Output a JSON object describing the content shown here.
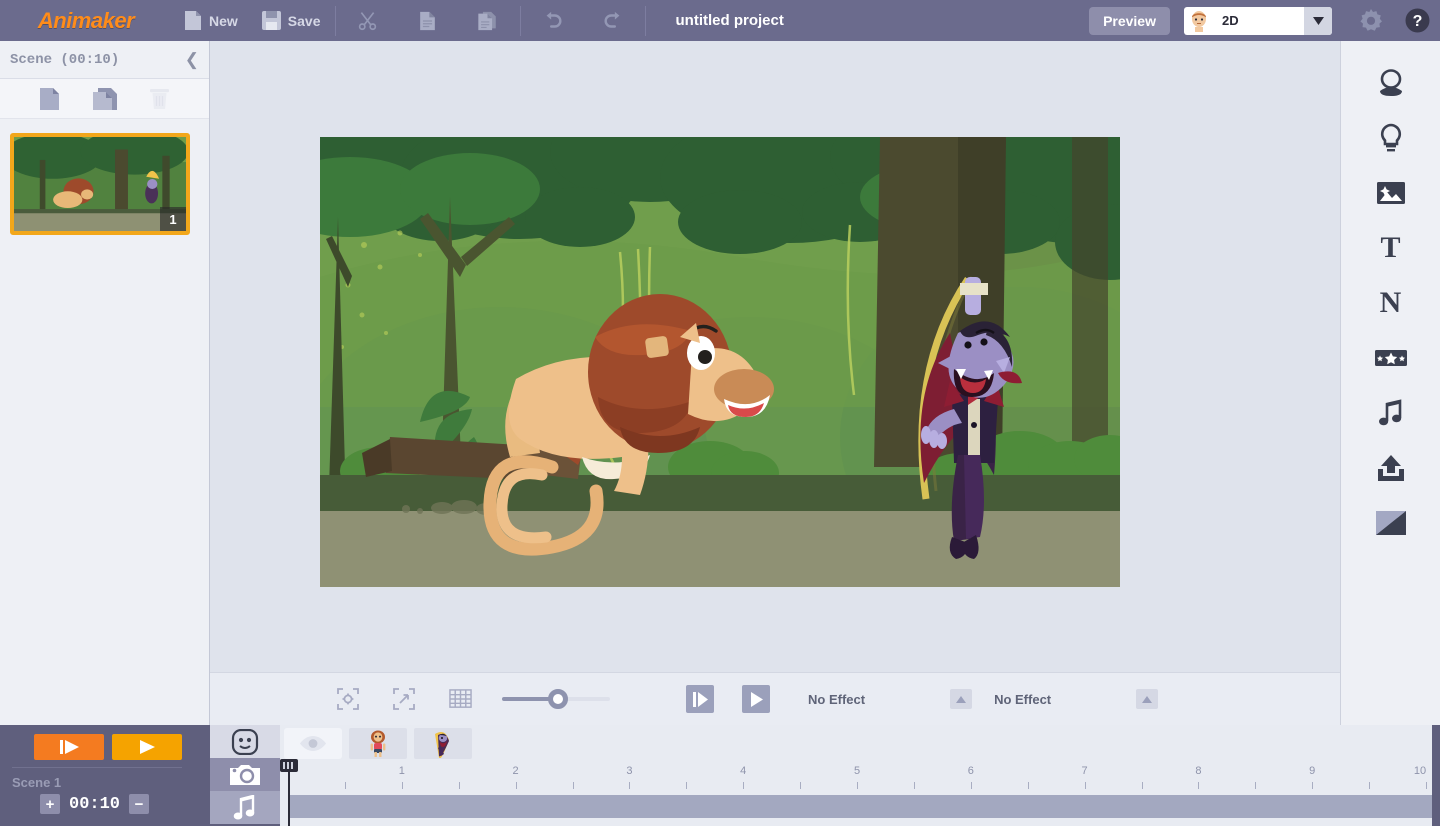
{
  "app": {
    "brand": "Animaker",
    "project_title": "untitled project"
  },
  "toolbar": {
    "new_label": "New",
    "save_label": "Save",
    "cut_icon": "scissors-icon",
    "copy_icon": "copy-icon",
    "paste_icon": "paste-icon",
    "undo_icon": "undo-icon",
    "redo_icon": "redo-icon",
    "preview_label": "Preview",
    "mode_value": "2D",
    "settings_icon": "gear-icon",
    "help_icon": "help-icon"
  },
  "scene_panel": {
    "title": "Scene  (00:10)",
    "collapse_icon": "chevron-left-icon",
    "new_scene_icon": "new-page-icon",
    "duplicate_scene_icon": "duplicate-page-icon",
    "delete_scene_icon": "trash-icon",
    "scenes": [
      {
        "number": "1",
        "selected": true
      }
    ]
  },
  "canvas_toolbar": {
    "center_icon": "center-target-icon",
    "fit_icon": "fit-expand-icon",
    "grid_icon": "grid-icon",
    "zoom_percent": 50,
    "enter_effect_icon": "enter-effect-icon",
    "exit_effect_icon": "exit-effect-icon",
    "enter_effect_label": "No Effect",
    "exit_effect_label": "No Effect",
    "caret_icon": "caret-up-icon"
  },
  "right_rail": {
    "items": [
      {
        "icon": "character-icon",
        "name": "characters"
      },
      {
        "icon": "bulb-icon",
        "name": "properties"
      },
      {
        "icon": "image-icon",
        "name": "images"
      },
      {
        "icon": "text-t-icon",
        "name": "text"
      },
      {
        "icon": "letter-n-icon",
        "name": "numbers"
      },
      {
        "icon": "stars-icon",
        "name": "effects"
      },
      {
        "icon": "music-note-icon",
        "name": "music"
      },
      {
        "icon": "upload-icon",
        "name": "upload"
      },
      {
        "icon": "background-icon",
        "name": "background"
      }
    ]
  },
  "playback": {
    "play_scene_icon": "play-scene-icon",
    "play_all_icon": "play-icon",
    "play_scene_color": "#f47b20",
    "play_all_color": "#f5a300",
    "scene_label": "Scene 1",
    "increase_label": "+",
    "duration": "00:10",
    "decrease_label": "−"
  },
  "timeline": {
    "tracks": [
      {
        "icon": "character-track-icon",
        "name": "character-track",
        "selected": false
      },
      {
        "icon": "camera-track-icon",
        "name": "camera-track",
        "selected": true
      },
      {
        "icon": "music-track-icon",
        "name": "music-track",
        "selected": false
      }
    ],
    "visibility_icon": "eye-icon",
    "items": [
      {
        "name": "lion-character"
      },
      {
        "name": "vampire-character"
      }
    ],
    "ruler_labels": [
      "1",
      "2",
      "3",
      "4",
      "5",
      "6",
      "7",
      "8",
      "9",
      "10"
    ],
    "playhead_position": "0"
  },
  "canvas_scene": {
    "description": "jungle-scene",
    "characters": [
      "lion",
      "vampire"
    ],
    "background_colors": {
      "sky_canopy": "#6f9c4a",
      "mid_foliage": "#4e7f46",
      "dark_foliage": "#2f6233",
      "ground": "#8e9173",
      "ground_dark": "#4a5c3c",
      "trunk": "#4b4a2f"
    }
  },
  "colors": {
    "topbar": "#6b6b8d",
    "brand_orange": "#ff8c1a",
    "panel": "#eef0f5",
    "stage": "#dfe3ec",
    "bottom": "#5f5f7d",
    "selection": "#f2a71b",
    "timeline_bar": "#a3a8c0"
  }
}
